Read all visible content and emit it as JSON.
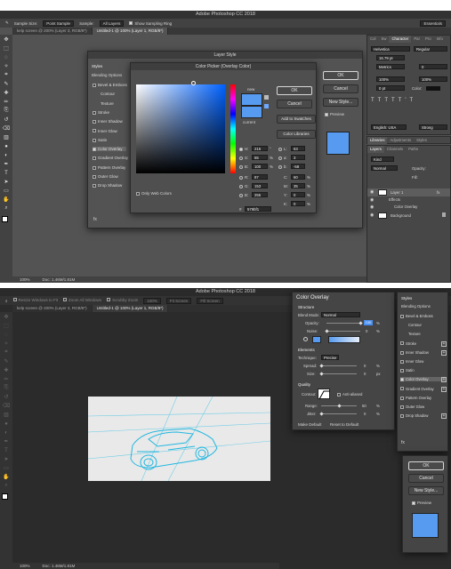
{
  "top": {
    "app_title": "Adobe Photoshop CC 2018",
    "options": {
      "sample_size_label": "Sample Size:",
      "sample_size_value": "Point Sample",
      "sample_label": "Sample:",
      "sample_value": "All Layers",
      "show_ring_label": "Show Sampling Ring",
      "workspace": "Essentials"
    },
    "tabs": [
      "kelp screen @ 200% (Layer 3, RGB/8*)",
      "Untitled-1 @ 100% (Layer 1, RGB/8*)"
    ],
    "layer_style": {
      "title": "Layer Style",
      "styles_header": "Styles",
      "blending_options": "Blending Options",
      "items": [
        {
          "label": "Bevel & Emboss",
          "checked": false,
          "indent": false
        },
        {
          "label": "Contour",
          "checked": false,
          "indent": true
        },
        {
          "label": "Texture",
          "checked": false,
          "indent": true
        },
        {
          "label": "Stroke",
          "checked": false,
          "indent": false
        },
        {
          "label": "Inner Shadow",
          "checked": false,
          "indent": false
        },
        {
          "label": "Inner Glow",
          "checked": false,
          "indent": false
        },
        {
          "label": "Satin",
          "checked": false,
          "indent": false
        },
        {
          "label": "Color Overlay",
          "checked": true,
          "indent": false,
          "active": true
        },
        {
          "label": "Gradient Overlay",
          "checked": false,
          "indent": false
        },
        {
          "label": "Pattern Overlay",
          "checked": false,
          "indent": false
        },
        {
          "label": "Outer Glow",
          "checked": false,
          "indent": false
        },
        {
          "label": "Drop Shadow",
          "checked": false,
          "indent": false
        }
      ],
      "fx_label": "fx",
      "ok": "OK",
      "cancel": "Cancel",
      "new_style": "New Style...",
      "preview": "Preview"
    },
    "color_picker": {
      "title": "Color Picker (Overlay Color)",
      "new_label": "new",
      "current_label": "current",
      "ok": "OK",
      "cancel": "Cancel",
      "add_to_swatches": "Add to Swatches",
      "color_libraries": "Color Libraries",
      "only_web_colors": "Only Web Colors",
      "color": "#579bf1",
      "fields": [
        {
          "label": "H:",
          "value": "216",
          "unit": "°"
        },
        {
          "label": "S:",
          "value": "65",
          "unit": "%"
        },
        {
          "label": "B:",
          "value": "100",
          "unit": "%"
        },
        {
          "label": "R:",
          "value": "87",
          "unit": ""
        },
        {
          "label": "G:",
          "value": "153",
          "unit": ""
        },
        {
          "label": "B:",
          "value": "255",
          "unit": ""
        }
      ],
      "lab_fields": [
        {
          "label": "L:",
          "value": "63",
          "unit": ""
        },
        {
          "label": "a:",
          "value": "3",
          "unit": ""
        },
        {
          "label": "b:",
          "value": "-58",
          "unit": ""
        },
        {
          "label": "C:",
          "value": "60",
          "unit": "%"
        },
        {
          "label": "M:",
          "value": "35",
          "unit": "%"
        },
        {
          "label": "Y:",
          "value": "0",
          "unit": "%"
        },
        {
          "label": "K:",
          "value": "0",
          "unit": "%"
        }
      ],
      "hex_label": "#",
      "hex_value": "579bf1"
    },
    "right_panel": {
      "char_tabs": [
        "Col",
        "Sw",
        "Character",
        "Par",
        "Pro",
        "Info"
      ],
      "font": "Helvetica",
      "style": "Regular",
      "size": "16.79 pt",
      "metrics": "Metrics",
      "tracking": "0",
      "scale_v": "100%",
      "scale_h": "100%",
      "baseline": "0 pt",
      "color_label": "Color:",
      "language": "English: USA",
      "aa": "Strong",
      "lib_tabs": [
        "Libraries",
        "Adjustments",
        "Styles"
      ],
      "layer_tabs": [
        "Layers",
        "Channels",
        "Paths"
      ],
      "kind": "Kind",
      "blend": "Normal",
      "opacity_label": "Opacity:",
      "fill_label": "Fill:",
      "layers": [
        {
          "name": "Layer 1",
          "fx": "fx"
        },
        {
          "name": "Effects",
          "sub": true
        },
        {
          "name": "Color Overlay",
          "sub": true
        },
        {
          "name": "Background",
          "lock": true
        }
      ]
    },
    "status": {
      "zoom": "100%",
      "doc": "Doc: 1.46M/1.81M"
    }
  },
  "bottom": {
    "app_title": "Adobe Photoshop CC 2018",
    "options": [
      "Resize Windows to Fit",
      "Zoom All Windows",
      "Scrubby Zoom",
      "100%",
      "Fit Screen",
      "Fill Screen"
    ],
    "tabs": [
      "kelp screen @ 200% (Layer 3, RGB/8*)",
      "Untitled-1 @ 100% (Layer 1, RGB/8*)"
    ],
    "color_overlay": {
      "title": "Color Overlay",
      "structure": "Structure",
      "blend_mode_label": "Blend Mode:",
      "blend_mode": "Normal",
      "opacity_label": "Opacity:",
      "opacity_value": "100",
      "noise_label": "Noise:",
      "noise_value": "0",
      "elements": "Elements",
      "technique_label": "Technique:",
      "technique": "Precise",
      "spread_label": "Spread:",
      "spread_value": "0",
      "size_label": "Size:",
      "size_value": "0",
      "quality": "Quality",
      "contour_label": "Contour:",
      "anti_aliased": "Anti-aliased",
      "range_label": "Range:",
      "range_value": "50",
      "jitter_label": "Jitter:",
      "jitter_value": "0",
      "pct": "%",
      "px": "px",
      "make_default": "Make Default",
      "reset_default": "Reset to Default",
      "color": "#579bf1"
    },
    "styles_panel": {
      "header": "Styles",
      "blending_options": "Blending Options",
      "items": [
        {
          "label": "Bevel & Emboss",
          "checked": false
        },
        {
          "label": "Contour",
          "checked": false,
          "indent": true
        },
        {
          "label": "Texture",
          "checked": false,
          "indent": true
        },
        {
          "label": "Stroke",
          "checked": false,
          "plus": true
        },
        {
          "label": "Inner Shadow",
          "checked": false,
          "plus": true
        },
        {
          "label": "Inner Glow",
          "checked": false
        },
        {
          "label": "Satin",
          "checked": false
        },
        {
          "label": "Color Overlay",
          "checked": true,
          "plus": true,
          "active": true
        },
        {
          "label": "Gradient Overlay",
          "checked": false,
          "plus": true
        },
        {
          "label": "Pattern Overlay",
          "checked": false
        },
        {
          "label": "Outer Glow",
          "checked": false
        },
        {
          "label": "Drop Shadow",
          "checked": false,
          "plus": true
        }
      ],
      "fx_label": "fx",
      "ok": "OK",
      "cancel": "Cancel",
      "new_style": "New Style...",
      "preview": "Preview"
    },
    "status": {
      "zoom": "100%",
      "doc": "Doc: 1.46M/1.81M"
    }
  }
}
